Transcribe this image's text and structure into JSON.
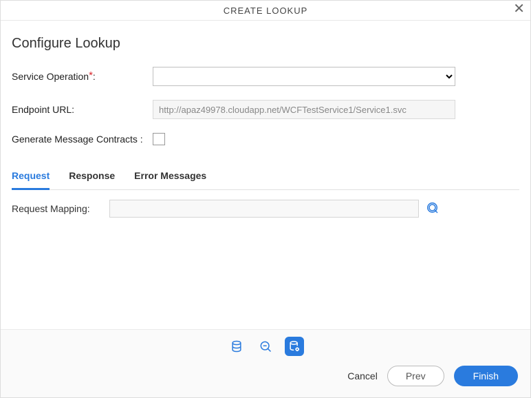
{
  "header": {
    "title": "CREATE LOOKUP"
  },
  "heading": "Configure Lookup",
  "form": {
    "service_operation_label": "Service Operation",
    "endpoint_url_label": "Endpoint URL:",
    "endpoint_url_value": "http://apaz49978.cloudapp.net/WCFTestService1/Service1.svc",
    "generate_contracts_label": "Generate Message Contracts :"
  },
  "tabs": [
    {
      "label": "Request",
      "active": true
    },
    {
      "label": "Response",
      "active": false
    },
    {
      "label": "Error Messages",
      "active": false
    }
  ],
  "tab_body": {
    "request_mapping_label": "Request Mapping:"
  },
  "buttons": {
    "cancel": "Cancel",
    "prev": "Prev",
    "finish": "Finish"
  }
}
